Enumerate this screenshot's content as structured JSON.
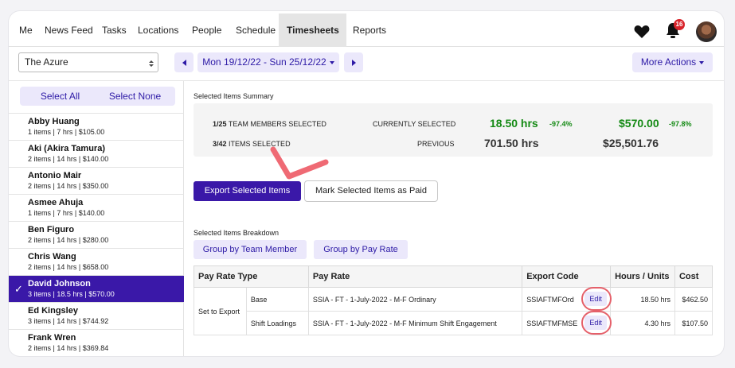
{
  "nav": {
    "items": [
      "Me",
      "News Feed",
      "Tasks",
      "Locations",
      "People",
      "Schedule",
      "Timesheets",
      "Reports"
    ],
    "active": "Timesheets",
    "notifications": "16",
    "icons": [
      "heart-icon",
      "bell-icon",
      "avatar"
    ]
  },
  "toolbar": {
    "location": "The Azure",
    "date_range": "Mon 19/12/22 - Sun 25/12/22",
    "more_actions": "More Actions"
  },
  "sidebar": {
    "select_all": "Select All",
    "select_none": "Select None",
    "people": [
      {
        "name": "Abby Huang",
        "stats": "1 items | 7 hrs | $105.00"
      },
      {
        "name": "Aki (Akira Tamura)",
        "stats": "2 items | 14 hrs | $140.00"
      },
      {
        "name": "Antonio Mair",
        "stats": "2 items | 14 hrs | $350.00"
      },
      {
        "name": "Asmee Ahuja",
        "stats": "1 items | 7 hrs | $140.00"
      },
      {
        "name": "Ben Figuro",
        "stats": "2 items | 14 hrs | $280.00"
      },
      {
        "name": "Chris Wang",
        "stats": "2 items | 14 hrs | $658.00"
      },
      {
        "name": "David Johnson",
        "stats": "3 items | 18.5 hrs | $570.00",
        "selected": true
      },
      {
        "name": "Ed Kingsley",
        "stats": "3 items | 14 hrs | $744.92"
      },
      {
        "name": "Frank Wren",
        "stats": "2 items | 14 hrs | $369.84"
      }
    ]
  },
  "summary": {
    "title": "Selected Items Summary",
    "team_count": "1/25",
    "team_label": "TEAM MEMBERS SELECTED",
    "items_count": "3/42",
    "items_label": "ITEMS SELECTED",
    "currently_label": "CURRENTLY SELECTED",
    "previous_label": "PREVIOUS",
    "current_hours": "18.50 hrs",
    "current_hours_pct": "-97.4%",
    "current_cost": "$570.00",
    "current_cost_pct": "-97.8%",
    "previous_hours": "701.50 hrs",
    "previous_cost": "$25,501.76"
  },
  "actions": {
    "export": "Export Selected Items",
    "mark_paid": "Mark Selected Items as Paid"
  },
  "breakdown": {
    "title": "Selected Items Breakdown",
    "group_member": "Group by Team Member",
    "group_rate": "Group by Pay Rate",
    "headers": [
      "Pay Rate Type",
      "Pay Rate",
      "Export Code",
      "Hours / Units",
      "Cost"
    ],
    "group_label": "Set to Export",
    "rows": [
      {
        "type": "Base",
        "rate": "SSIA - FT - 1-July-2022 - M-F Ordinary",
        "code": "SSIAFTMFOrd",
        "edit": "Edit",
        "hours": "18.50 hrs",
        "cost": "$462.50"
      },
      {
        "type": "Shift Loadings",
        "rate": "SSIA - FT - 1-July-2022 - M-F Minimum Shift Engagement",
        "code": "SSIAFTMFMSE",
        "edit": "Edit",
        "hours": "4.30 hrs",
        "cost": "$107.50"
      }
    ]
  },
  "colors": {
    "primary": "#3a18a8",
    "accent_light": "#ebe8fb",
    "positive": "#148a14",
    "annotation": "#e5606a"
  }
}
